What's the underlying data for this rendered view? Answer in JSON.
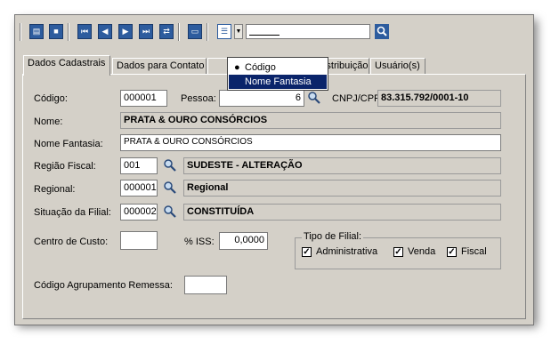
{
  "toolbar": {
    "buttons": [
      "new-document-icon",
      "delete-icon",
      "first-record-icon",
      "previous-record-icon",
      "next-record-icon",
      "last-record-icon",
      "refresh-icon",
      "print-icon",
      "list-icon"
    ]
  },
  "dropdown_menu": {
    "items": [
      {
        "label": "Código",
        "selected": true
      },
      {
        "label": "Nome Fantasia",
        "highlighted": true
      }
    ]
  },
  "tabs": [
    "Dados Cadastrais",
    "Dados para Contato",
    "Distribuição",
    "Usuário(s)"
  ],
  "form": {
    "codigo_label": "Código:",
    "codigo_value": "000001",
    "pessoa_label": "Pessoa:",
    "pessoa_value": "6",
    "cnpj_label": "CNPJ/CPF:",
    "cnpj_value": "83.315.792/0001-10",
    "nome_label": "Nome:",
    "nome_value": "PRATA & OURO CONSÓRCIOS",
    "fantasia_label": "Nome Fantasia:",
    "fantasia_value": "PRATA & OURO CONSÓRCIOS",
    "regiao_label": "Região Fiscal:",
    "regiao_code": "001",
    "regiao_desc": "SUDESTE - ALTERAÇÃO",
    "regional_label": "Regional:",
    "regional_code": "000001",
    "regional_desc": "Regional",
    "situacao_label": "Situação da Filial:",
    "situacao_code": "000002",
    "situacao_desc": "CONSTITUÍDA",
    "centro_label": "Centro de Custo:",
    "centro_value": "",
    "iss_label": "% ISS:",
    "iss_value": "0,0000",
    "tipo_label": "Tipo de Filial:",
    "tipo_options": [
      {
        "label": "Administrativa",
        "checked": true
      },
      {
        "label": "Venda",
        "checked": true
      },
      {
        "label": "Fiscal",
        "checked": true
      }
    ],
    "agrup_label": "Código Agrupamento Remessa:",
    "agrup_value": ""
  },
  "colors": {
    "toolbar_icon": "#2d5c9e",
    "menu_highlight": "#0a246a",
    "window_bg": "#d4d0c8"
  }
}
